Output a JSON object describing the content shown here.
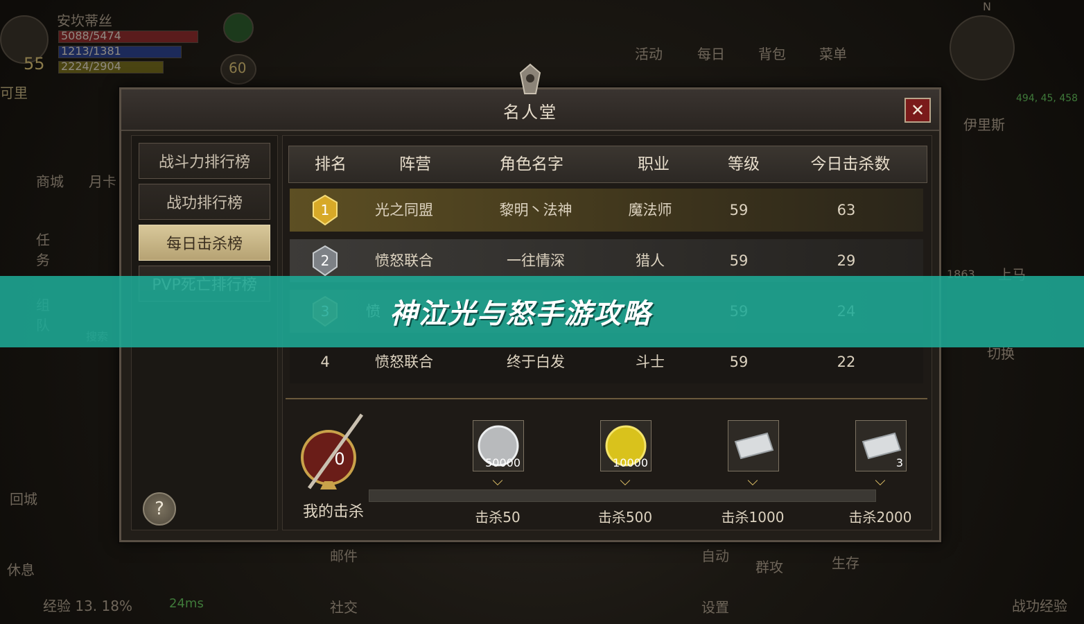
{
  "hud": {
    "player_name": "安坎蒂丝",
    "player_level": "55",
    "hp": "5088/5474",
    "mp": "1213/1381",
    "exp_bar": "2224/2904",
    "secondary_level": "60",
    "location_fragment": "可里",
    "menu_items": [
      "活动",
      "每日",
      "背包",
      "菜单"
    ],
    "minimap_coords": "494, 45, 458",
    "minimap_target": "伊里斯",
    "compass_n": "N",
    "left_items": [
      "商城",
      "月卡",
      "任务",
      "组队",
      "搜索",
      "回城",
      "休息"
    ],
    "right_items": [
      "上马",
      "切换"
    ],
    "right_value": "1863",
    "bottom_items": [
      "邮件",
      "社交",
      "自动",
      "设置",
      "群攻",
      "生存"
    ],
    "exp_label": "经验 13. 18%",
    "ping": "24ms",
    "battle_exp": "战功经验"
  },
  "dialog": {
    "title": "名人堂",
    "close_label": "✕"
  },
  "tabs": [
    {
      "label": "战斗力排行榜",
      "active": false
    },
    {
      "label": "战功排行榜",
      "active": false
    },
    {
      "label": "每日击杀榜",
      "active": true
    },
    {
      "label": "PVP死亡排行榜",
      "active": false
    }
  ],
  "help_label": "?",
  "table": {
    "headers": [
      "排名",
      "阵营",
      "角色名字",
      "职业",
      "等级",
      "今日击杀数"
    ],
    "rows": [
      {
        "rank": "1",
        "faction": "光之同盟",
        "name": "黎明丶法神",
        "class": "魔法师",
        "level": "59",
        "kills": "63"
      },
      {
        "rank": "2",
        "faction": "愤怒联合",
        "name": "一往情深",
        "class": "猎人",
        "level": "59",
        "kills": "29"
      },
      {
        "rank": "3",
        "faction": "愤",
        "name": "",
        "class": "",
        "level": "59",
        "kills": "24"
      },
      {
        "rank": "4",
        "faction": "愤怒联合",
        "name": "终于白发",
        "class": "斗士",
        "level": "59",
        "kills": "22"
      }
    ]
  },
  "my_kills": {
    "count": "0",
    "label": "我的击杀",
    "progress": 0
  },
  "rewards": [
    {
      "label": "击杀50",
      "count": "50000",
      "icon": "silver-coin"
    },
    {
      "label": "击杀500",
      "count": "10000",
      "icon": "gold-coin"
    },
    {
      "label": "击杀1000",
      "count": "",
      "icon": "ticket"
    },
    {
      "label": "击杀2000",
      "count": "3",
      "icon": "ticket"
    }
  ],
  "banner": {
    "text": "神泣光与怒手游攻略"
  },
  "colors": {
    "banner": "#1eaa96",
    "gold_row": "#5d4f23",
    "active_tab": "#d8c89a",
    "close_button": "#7a1a1a"
  }
}
